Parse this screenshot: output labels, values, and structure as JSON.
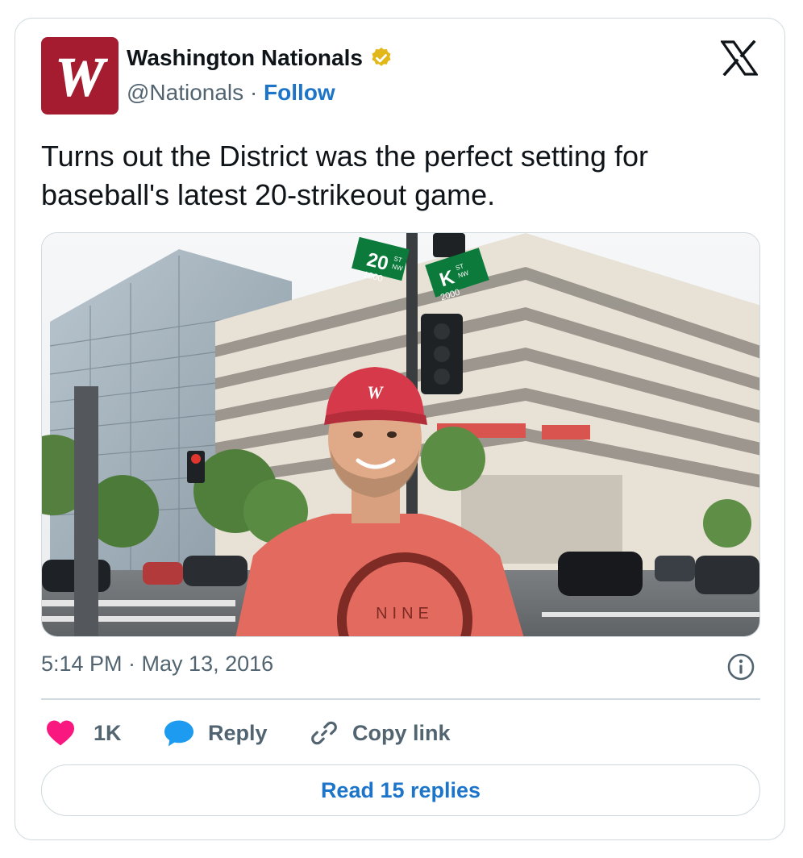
{
  "account": {
    "display_name": "Washington Nationals",
    "handle": "@Nationals",
    "separator": "·",
    "follow_label": "Follow",
    "verified": true,
    "logo_letter": "W"
  },
  "tweet": {
    "text": "Turns out the District was the perfect setting for baseball's latest 20-strikeout game.",
    "timestamp": "5:14 PM · May 13, 2016"
  },
  "photo": {
    "street_signs": {
      "left_number": "20",
      "left_suffix": "ST",
      "left_dir": "NW",
      "left_block": "1000",
      "right_letter": "K",
      "right_suffix": "ST",
      "right_dir": "NW",
      "right_block": "2000"
    },
    "cap_logo": "W",
    "shirt_text": "NINE"
  },
  "actions": {
    "like_count": "1K",
    "reply_label": "Reply",
    "copy_link_label": "Copy link"
  },
  "read_replies_label": "Read 15 replies",
  "colors": {
    "link_blue": "#1d75c9",
    "like_pink": "#f91880",
    "reply_blue": "#1d9bf0",
    "brand_red": "#a51c30",
    "badge_gold": "#e2b719"
  },
  "icons": {
    "platform": "x-logo-icon",
    "verified": "verified-badge-icon",
    "info": "info-icon",
    "like": "heart-icon",
    "reply": "reply-bubble-icon",
    "copy": "link-icon"
  }
}
